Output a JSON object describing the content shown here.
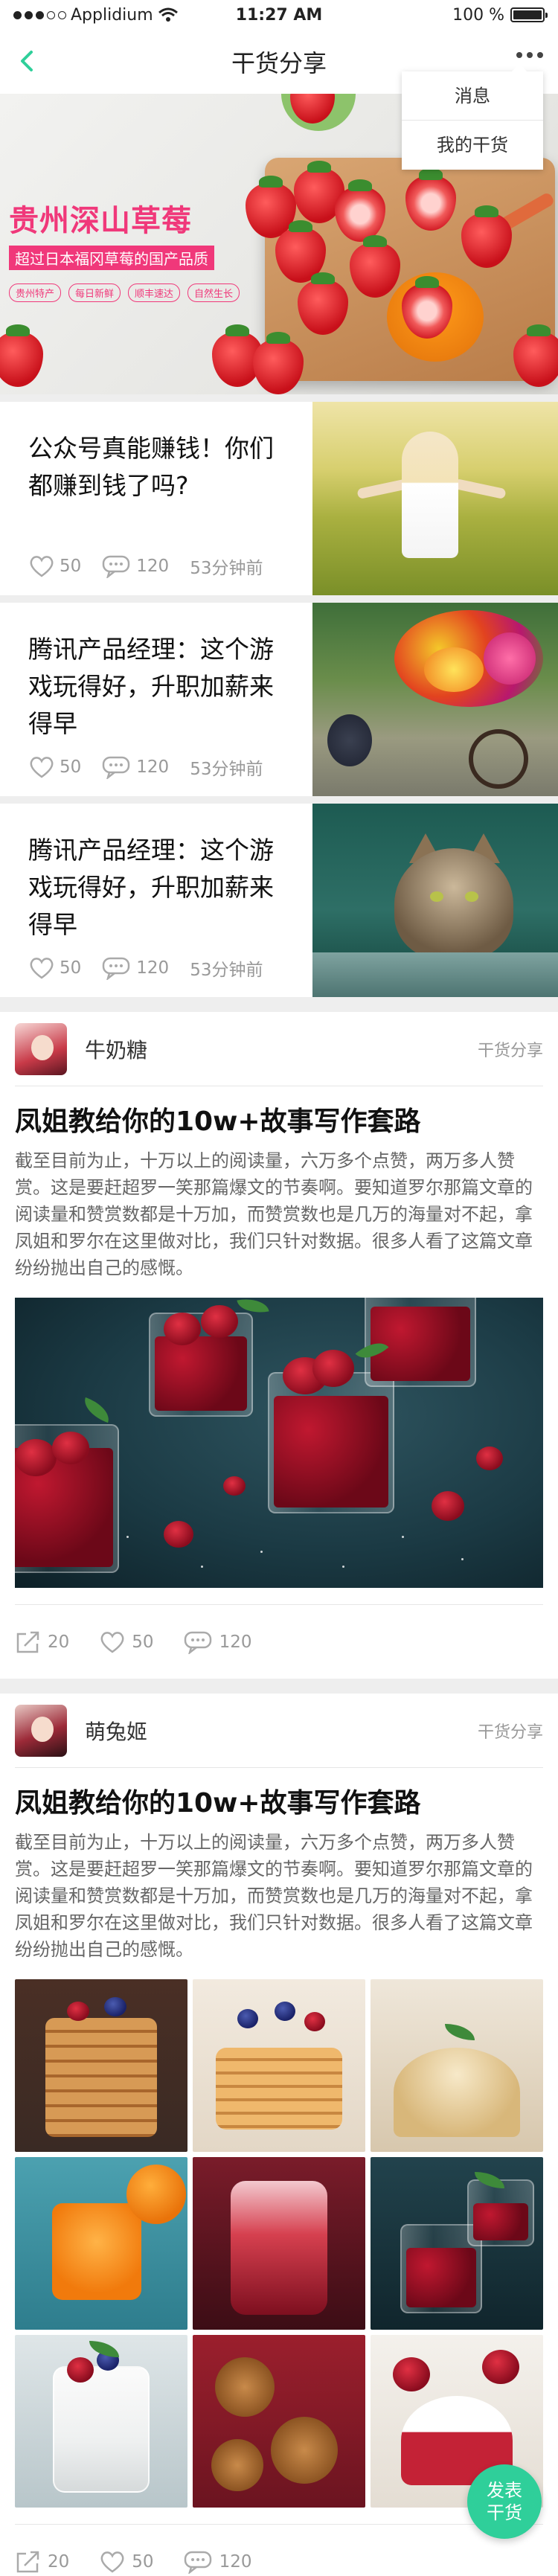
{
  "status_bar": {
    "carrier": "Applidium",
    "time": "11:27 AM",
    "battery": "100 %",
    "battery_level": 1.0
  },
  "nav": {
    "title": "干货分享",
    "back_icon": "chevron-left-icon",
    "more_icon": "more-dots-icon",
    "accent_color": "#2fcf9a"
  },
  "dropdown": {
    "items": [
      "消息",
      "我的干货"
    ]
  },
  "banner": {
    "title_part1": "贵州",
    "title_part2": "深山草莓",
    "subtitle": "超过日本福冈草莓的国产品质",
    "tags": [
      "贵州特产",
      "每日新鲜",
      "顺丰速达",
      "自然生长"
    ],
    "brand_color": "#f0387a"
  },
  "articles": [
    {
      "title": "公众号真能赚钱！你们都赚到钱了吗?",
      "likes": "50",
      "comments": "120",
      "time": "53分钟前"
    },
    {
      "title": "腾讯产品经理：这个游戏玩得好，升职加薪来得早",
      "likes": "50",
      "comments": "120",
      "time": "53分钟前"
    },
    {
      "title": "腾讯产品经理：这个游戏玩得好，升职加薪来得早",
      "likes": "50",
      "comments": "120",
      "time": "53分钟前"
    }
  ],
  "posts": [
    {
      "author": "牛奶糖",
      "category": "干货分享",
      "title": "凤姐教给你的10w+故事写作套路",
      "body": "截至目前为止，十万以上的阅读量，六万多个点赞，两万多人赞赏。这是要赶超罗一笑那篇爆文的节奏啊。要知道罗尔那篇文章的阅读量和赞赏数都是十万加，而赞赏数也是几万的海量对不起，拿凤姐和罗尔在这里做对比，我们只针对数据。很多人看了这篇文章纷纷抛出自己的感慨。",
      "shares": "20",
      "likes": "50",
      "comments": "120"
    },
    {
      "author": "萌兔姬",
      "category": "干货分享",
      "title": "凤姐教给你的10w+故事写作套路",
      "body": "截至目前为止，十万以上的阅读量，六万多个点赞，两万多人赞赏。这是要赶超罗一笑那篇爆文的节奏啊。要知道罗尔那篇文章的阅读量和赞赏数都是十万加，而赞赏数也是几万的海量对不起，拿凤姐和罗尔在这里做对比，我们只针对数据。很多人看了这篇文章纷纷抛出自己的感慨。",
      "shares": "20",
      "likes": "50",
      "comments": "120"
    }
  ],
  "fab": {
    "line1": "发表",
    "line2": "干货"
  }
}
